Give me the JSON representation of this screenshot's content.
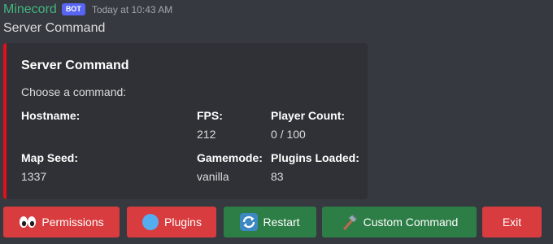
{
  "message": {
    "username": "Minecord",
    "bot_tag": "BOT",
    "timestamp": "Today at 10:43 AM",
    "content": "Server Command"
  },
  "embed": {
    "accent_color": "#e3101b",
    "title": "Server Command",
    "description": "Choose a command:",
    "fields": {
      "hostname": {
        "name": "Hostname:",
        "value": ""
      },
      "fps": {
        "name": "FPS:",
        "value": "212"
      },
      "player_count": {
        "name": "Player Count:",
        "value": "0 / 100"
      },
      "map_seed": {
        "name": "Map Seed:",
        "value": "1337"
      },
      "gamemode": {
        "name": "Gamemode:",
        "value": "vanilla"
      },
      "plugins_loaded": {
        "name": "Plugins Loaded:",
        "value": "83"
      }
    }
  },
  "buttons": {
    "permissions": {
      "label": "Permissions",
      "icon": "eyes-emoji-icon",
      "style": "danger"
    },
    "plugins": {
      "label": "Plugins",
      "icon": "blue-circle-emoji-icon",
      "style": "danger"
    },
    "restart": {
      "label": "Restart",
      "icon": "arrows-counterclockwise-emoji-icon",
      "style": "success"
    },
    "custom_command": {
      "label": "Custom Command",
      "icon": "hammer-emoji-icon",
      "style": "success"
    },
    "exit": {
      "label": "Exit",
      "style": "danger"
    }
  },
  "colors": {
    "username": "#43b581",
    "bot_tag": "#5865f2",
    "danger": "#d83c3e",
    "success": "#2d7d46",
    "background": "#36393f",
    "embed_background": "#2f3136"
  }
}
